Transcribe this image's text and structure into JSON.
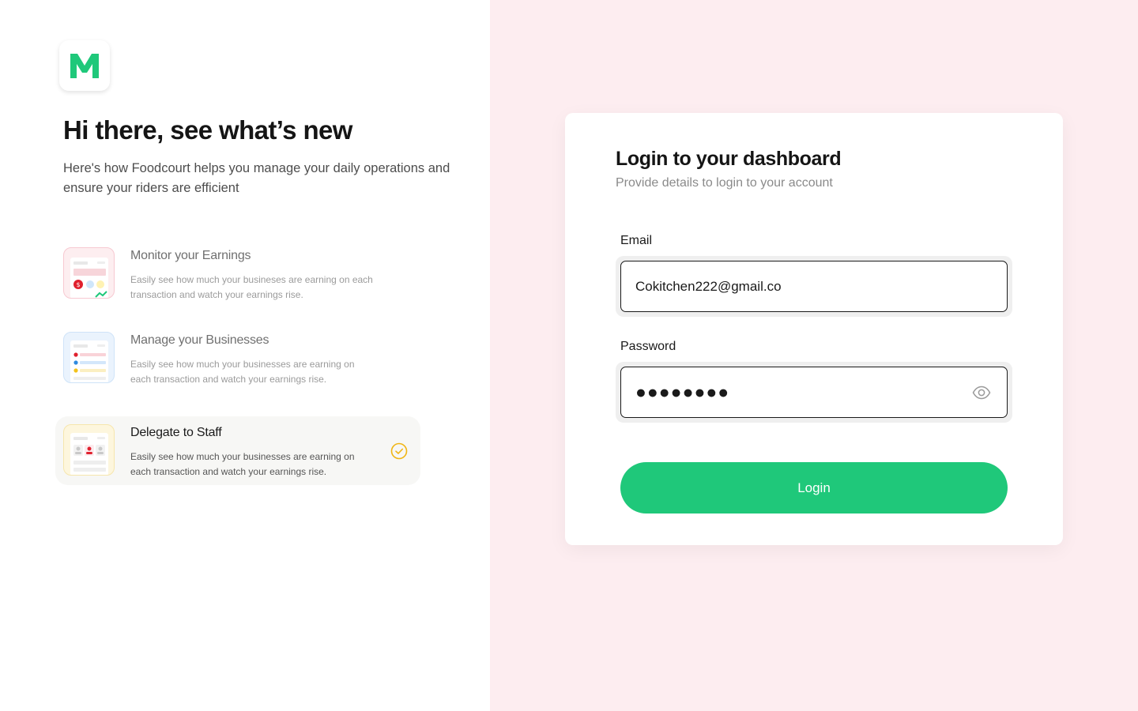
{
  "brand": {
    "logo_letter": "M",
    "accent_color": "#1fc87a",
    "right_panel_color": "#fdedf0"
  },
  "intro": {
    "title": "Hi there, see what’s new",
    "subtitle": "Here's how Foodcourt helps you manage your daily operations and ensure your riders are efficient"
  },
  "features": [
    {
      "title": "Monitor your Earnings",
      "description": "Easily see how much your busineses are earning  on each transaction and watch your earnings rise.",
      "icon": "earnings-illustration",
      "active": false
    },
    {
      "title": "Manage your Businesses",
      "description": "Easily see how much your businesses are earning  on each transaction and watch your earnings rise.",
      "icon": "businesses-illustration",
      "active": false
    },
    {
      "title": "Delegate to Staff",
      "description": "Easily see how much your businesses are earning  on each transaction and watch your earnings rise.",
      "icon": "staff-illustration",
      "active": true,
      "status_icon": "check-circle-icon"
    }
  ],
  "login": {
    "title": "Login to your dashboard",
    "subtitle": "Provide details to login to your account",
    "email_label": "Email",
    "email_value": "Cokitchen222@gmail.co",
    "password_label": "Password",
    "password_mask": "●●●●●●●●",
    "password_toggle_icon": "eye-icon",
    "submit_label": "Login"
  }
}
